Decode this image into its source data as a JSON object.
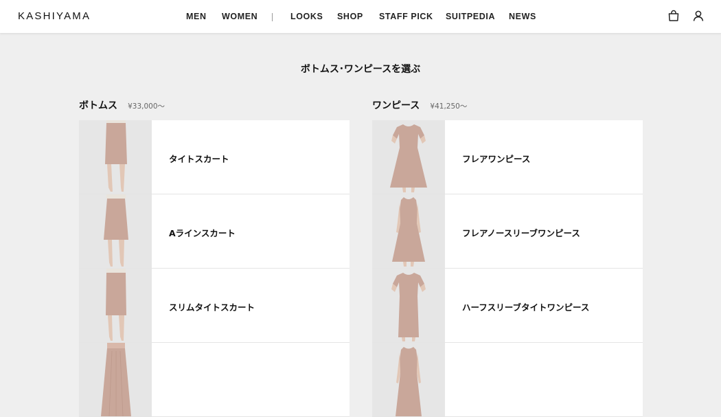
{
  "header": {
    "logo": "KASHIYAMA",
    "nav": [
      "MEN",
      "WOMEN",
      "LOOKS",
      "SHOP",
      "STAFF PICK",
      "SUITPEDIA",
      "NEWS"
    ],
    "icons": [
      "bag-icon",
      "account-icon"
    ]
  },
  "page": {
    "title": "ボトムス･ワンピースを選ぶ"
  },
  "columns": [
    {
      "title": "ボトムス",
      "price": "¥33,000～",
      "items": [
        {
          "label": "タイトスカート",
          "image": "skirt-image"
        },
        {
          "label": "Aラインスカート",
          "image": "skirt-image"
        },
        {
          "label": "スリムタイトスカート",
          "image": "skirt-image"
        },
        {
          "label": "",
          "image": "skirt-image"
        }
      ]
    },
    {
      "title": "ワンピース",
      "price": "¥41,250～",
      "items": [
        {
          "label": "フレアワンピース",
          "image": "dress-image"
        },
        {
          "label": "フレアノースリーブワンピース",
          "image": "dress-image"
        },
        {
          "label": "ハーフスリーブタイトワンピース",
          "image": "dress-image"
        },
        {
          "label": "",
          "image": "dress-image"
        }
      ]
    }
  ],
  "colors": {
    "garment": "#c9a79a",
    "background": "#efefef",
    "card": "#ffffff"
  }
}
